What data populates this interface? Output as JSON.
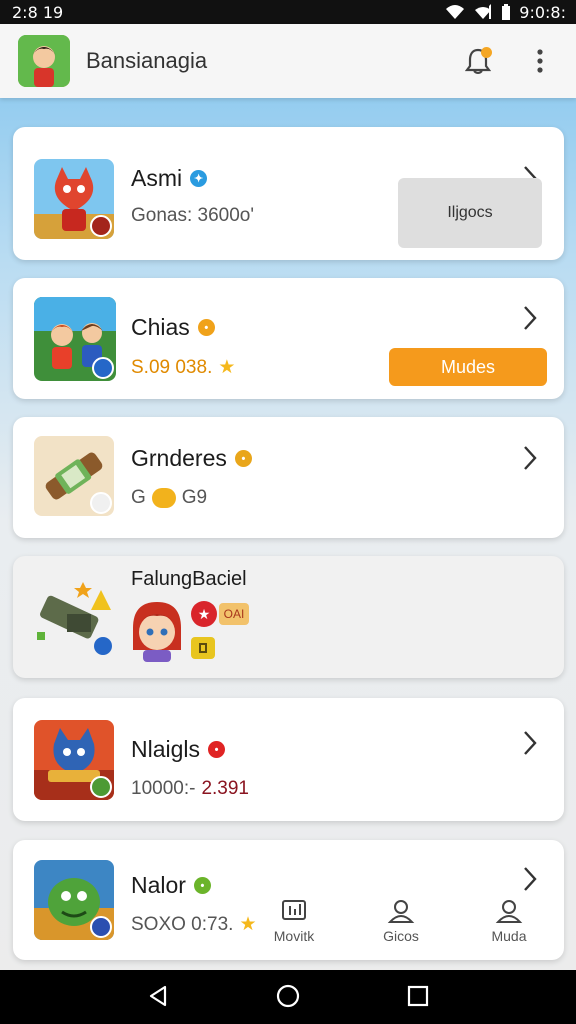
{
  "status_bar": {
    "time_left": "2:8 19",
    "time_right": "9:0:8:"
  },
  "app_bar": {
    "title": "Bansianagia",
    "logo_icon": "app-logo-icon"
  },
  "cards": [
    {
      "title": "Asmi",
      "badge_color": "#2a9be0",
      "subtitle": "Gonas: 3600o'",
      "action_label": "Iljgocs"
    },
    {
      "title": "Chias",
      "badge_color": "#f0a21a",
      "subtitle_value": "S.09 038.",
      "subtitle_color": "#e08a00",
      "action_label": "Mudes"
    },
    {
      "title": "Grnderes",
      "badge_color": "#e9a61b",
      "subtitle_prefix": "G",
      "subtitle_value": "G9"
    },
    {
      "title": "FalungBaciel",
      "tag_label": "OAI"
    },
    {
      "title": "Nlaigls",
      "badge_color": "#e02424",
      "subtitle_prefix": "10000:-",
      "subtitle_value": "2.391",
      "subtitle_color": "#8a1420"
    },
    {
      "title": "Nalor",
      "badge_color": "#6bb42a",
      "subtitle_value": "SOXO 0:73."
    }
  ],
  "bottom_tabs": [
    {
      "label": "Movitk",
      "icon": "chart-icon"
    },
    {
      "label": "Gicos",
      "icon": "person-icon"
    },
    {
      "label": "Muda",
      "icon": "person-icon"
    }
  ],
  "colors": {
    "accent_orange": "#f59a1c",
    "sky_blue": "#7ec3ee"
  }
}
